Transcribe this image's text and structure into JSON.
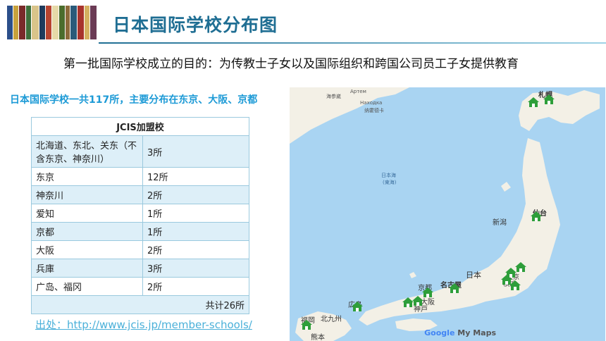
{
  "header": {
    "title": "日本国际学校分布图"
  },
  "subtitle": "第一批国际学校成立的目的：为传教士子女以及国际组织和跨国公司员工子女提供教育",
  "summary": "日本国际学校一共117所，主要分布在东京、大阪、京都",
  "table": {
    "header": "JCIS加盟校",
    "rows": [
      {
        "region": "北海道、东北、关东（不含东京、神奈川）",
        "count": "3所"
      },
      {
        "region": "东京",
        "count": "12所"
      },
      {
        "region": "神奈川",
        "count": "2所"
      },
      {
        "region": "爱知",
        "count": "1所"
      },
      {
        "region": "京都",
        "count": "1所"
      },
      {
        "region": "大阪",
        "count": "2所"
      },
      {
        "region": "兵庫",
        "count": "3所"
      },
      {
        "region": "广岛、福冈",
        "count": "2所"
      }
    ],
    "total": "共计26所"
  },
  "source": "出处：http://www.jcis.jp/member-schools/",
  "map": {
    "labels": {
      "sapporo": "札幌",
      "sendai": "仙台",
      "niigata": "新潟",
      "japan": "日本",
      "nagoya": "名古屋",
      "kyoto": "京都",
      "osaka": "大阪",
      "kobe": "神戸",
      "hiroshima": "広島",
      "fukuoka": "福岡",
      "kitakyushu": "北九州",
      "kumamoto": "熊本",
      "yokohama": "横浜",
      "tokyo": "東京",
      "sea": "日本海",
      "sea_sub": "(東海)",
      "vladivostok": "海参崴",
      "artem": "Артем",
      "nakhodka": "Находка",
      "nakhodka_cn": "纳霍德卡"
    },
    "brand": "Google",
    "brand_suffix": "My Maps",
    "colors": {
      "water": "#a9d4f2",
      "land": "#f3f0e6",
      "marker": "#2e9e3a"
    }
  }
}
